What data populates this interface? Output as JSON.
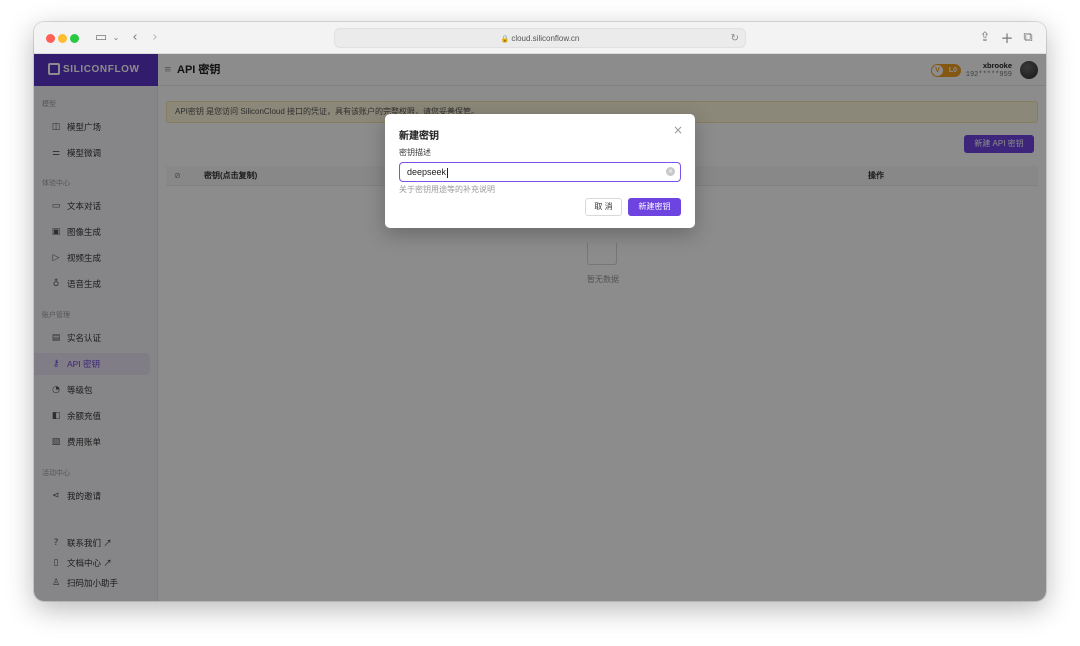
{
  "browser": {
    "url": "cloud.siliconflow.cn",
    "icons": {
      "sidebar": "sidebar-icon",
      "back": "back-icon",
      "forward": "forward-icon",
      "share": "share-icon",
      "new_tab": "new-tab-icon",
      "tabs": "tab-overview-icon",
      "reload": "reload-icon",
      "lock": "lock-icon"
    }
  },
  "sidebar": {
    "logo_text": "SILICONFLOW",
    "sections": [
      {
        "title": "模型",
        "items": [
          {
            "label": "模型广场",
            "icon": "cube-icon"
          },
          {
            "label": "模型微调",
            "icon": "sliders-icon"
          }
        ]
      },
      {
        "title": "体验中心",
        "items": [
          {
            "label": "文本对话",
            "icon": "chat-icon"
          },
          {
            "label": "图像生成",
            "icon": "image-icon"
          },
          {
            "label": "视频生成",
            "icon": "video-icon"
          },
          {
            "label": "语音生成",
            "icon": "microphone-icon"
          }
        ]
      },
      {
        "title": "账户管理",
        "items": [
          {
            "label": "实名认证",
            "icon": "id-card-icon"
          },
          {
            "label": "API 密钥",
            "icon": "key-icon",
            "active": true
          },
          {
            "label": "等级包",
            "icon": "gauge-icon"
          },
          {
            "label": "余额充值",
            "icon": "wallet-icon"
          },
          {
            "label": "费用账单",
            "icon": "bill-icon"
          }
        ]
      },
      {
        "title": "活动中心",
        "items": [
          {
            "label": "我的邀请",
            "icon": "share-nodes-icon"
          }
        ]
      }
    ],
    "footer": [
      {
        "label": "联系我们 ↗",
        "icon": "help-icon"
      },
      {
        "label": "文档中心 ↗",
        "icon": "document-icon"
      },
      {
        "label": "扫码加小助手",
        "icon": "person-icon"
      }
    ]
  },
  "header": {
    "title": "API 密钥",
    "level": "L0",
    "level_badge_letter": "V",
    "username": "xbrooke",
    "phone": "192*****959"
  },
  "main": {
    "notice": "API密钥 是您访问 SiliconCloud 接口的凭证，具有该账户的完整权限，请您妥善保管。",
    "new_key_button": "新建 API 密钥",
    "columns": {
      "key": "密钥(点击复制)",
      "actions": "操作"
    },
    "empty_text": "暂无数据"
  },
  "modal": {
    "title": "新建密钥",
    "field_label": "密钥描述",
    "input_value": "deepseek",
    "help_text": "关于密钥用途等的补充说明",
    "cancel_label": "取 消",
    "create_label": "新建密钥"
  },
  "colors": {
    "accent": "#6e44e0",
    "logo_bg": "#5b33c7",
    "notice_bg": "#fdf7dc",
    "badge": "#f0a020"
  }
}
